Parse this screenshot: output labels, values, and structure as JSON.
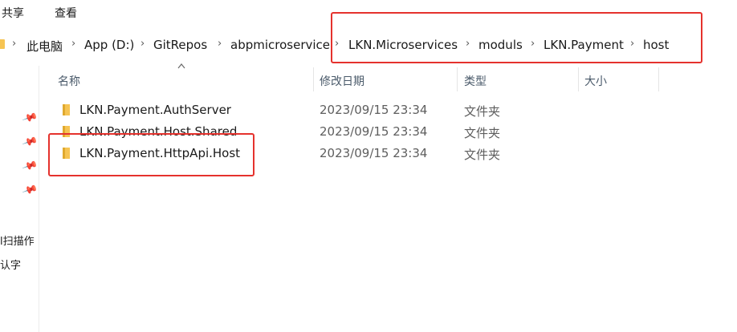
{
  "ribbon": {
    "tabs": [
      {
        "label": "共享"
      },
      {
        "label": "查看"
      }
    ]
  },
  "address_bar": {
    "crumbs": [
      {
        "label": "此电脑"
      },
      {
        "label": "App (D:)"
      },
      {
        "label": "GitRepos"
      },
      {
        "label": "abpmicroservice"
      },
      {
        "label": "LKN.Microservices"
      },
      {
        "label": "moduls"
      },
      {
        "label": "LKN.Payment"
      },
      {
        "label": "host"
      }
    ]
  },
  "nav_pane": {
    "labels": [
      {
        "label": "l扫描作"
      },
      {
        "label": "认字"
      }
    ]
  },
  "columns": {
    "name": "名称",
    "date": "修改日期",
    "type": "类型",
    "size": "大小"
  },
  "files": [
    {
      "name": "LKN.Payment.AuthServer",
      "date": "2023/09/15 23:34",
      "type": "文件夹"
    },
    {
      "name": "LKN.Payment.Host.Shared",
      "date": "2023/09/15 23:34",
      "type": "文件夹"
    },
    {
      "name": "LKN.Payment.HttpApi.Host",
      "date": "2023/09/15 23:34",
      "type": "文件夹"
    }
  ],
  "colors": {
    "highlight": "#e5322d",
    "folder": "#f6c453"
  }
}
